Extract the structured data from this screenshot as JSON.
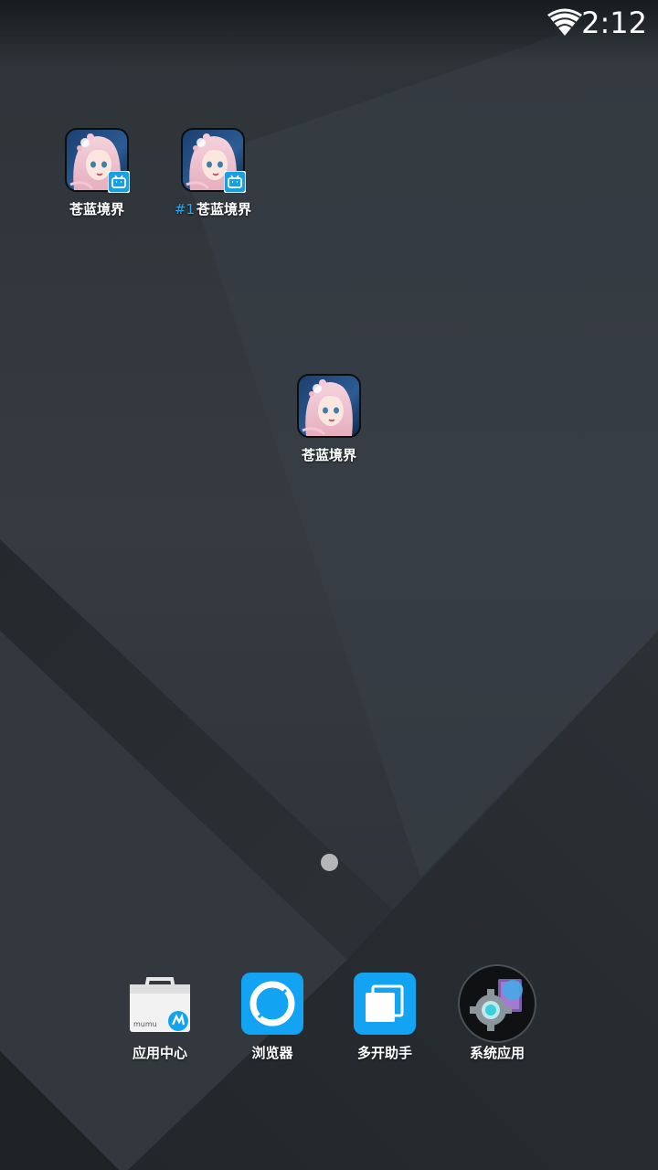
{
  "status_bar": {
    "time": "2:12",
    "wifi_icon": "wifi-icon"
  },
  "home": {
    "apps": [
      {
        "label": "苍蓝境界",
        "prefix": "",
        "icon": "game-app-icon",
        "badge": "bilibili-badge-icon"
      },
      {
        "label": "苍蓝境界",
        "prefix": "#1",
        "icon": "game-app-icon",
        "badge": "bilibili-badge-icon"
      },
      {
        "label": "苍蓝境界",
        "prefix": "",
        "icon": "game-app-icon"
      }
    ],
    "page_indicator": {
      "pages": 1,
      "current": 1
    }
  },
  "dock": {
    "apps": [
      {
        "label": "应用中心",
        "icon": "app-center-icon",
        "brand_text": "mumu"
      },
      {
        "label": "浏览器",
        "icon": "browser-icon",
        "color": "#12a4f2"
      },
      {
        "label": "多开助手",
        "icon": "multi-open-icon",
        "color": "#12a4f2"
      },
      {
        "label": "系统应用",
        "icon": "system-apps-icon"
      }
    ]
  },
  "colors": {
    "wallpaper_base": "#2f3439",
    "accent_blue": "#12a4f2",
    "prefix_blue": "#2ea6e8"
  }
}
